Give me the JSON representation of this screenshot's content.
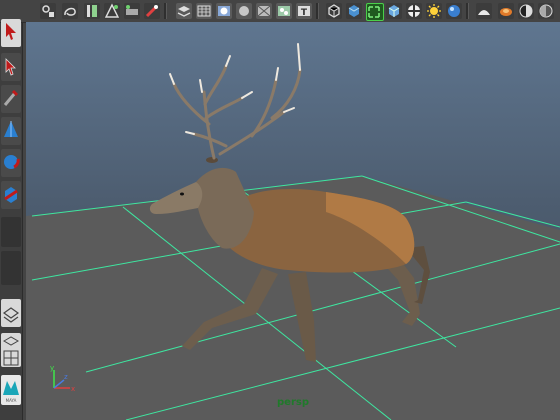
{
  "viewport": {
    "camera_label": "persp"
  },
  "axis": {
    "x": "x",
    "y": "y",
    "z": "z"
  },
  "colors": {
    "grid": "#3ee6a0",
    "accent": "#ffd23a",
    "brand_red": "#c01a1a"
  },
  "toolbar_icons": [
    "select-icon",
    "lasso-icon",
    "paint-icon",
    "snap-grid-icon",
    "snap-curve-icon",
    "snap-point-icon",
    "camera-icon",
    "wireframe-icon",
    "smooth-shade-icon",
    "texture-icon",
    "light-icon",
    "xray-icon",
    "isolate-icon",
    "resolution-gate-icon",
    "field-chart-icon",
    "safe-action-icon",
    "shadow-icon",
    "ao-icon",
    "aa-icon",
    "dof-icon"
  ],
  "toolbox_icons": [
    "select-tool-icon",
    "move-tool-icon",
    "rotate-tool-icon",
    "scale-tool-icon",
    "manipulator-icon",
    "layout-single-icon",
    "layout-four-icon",
    "maya-logo-icon"
  ],
  "logo_text": "MAYA"
}
